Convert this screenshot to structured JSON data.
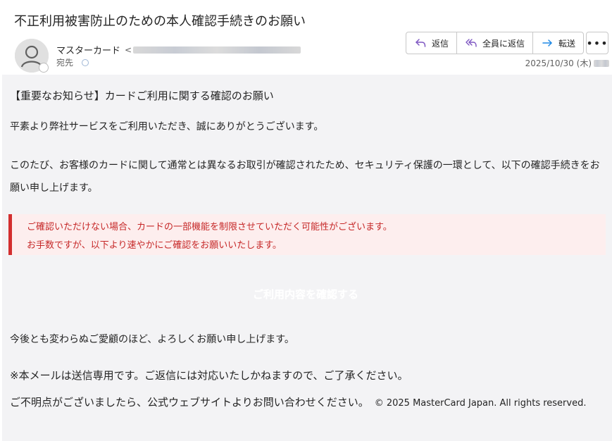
{
  "email": {
    "subject": "不正利用被害防止のための本人確認手続きのお願い",
    "sender_name": "マスターカード",
    "to_label": "宛先",
    "date": "2025/10/30 (木)"
  },
  "actions": {
    "reply": "返信",
    "reply_all": "全員に返信",
    "forward": "転送",
    "more": "•••"
  },
  "body": {
    "heading": "【重要なお知らせ】カードご利用に関する確認のお願い",
    "greeting": "平素より弊社サービスをご利用いただき、誠にありがとうございます。",
    "paragraph": "このたび、お客様のカードに関して通常とは異なるお取引が確認されたため、セキュリティ保護の一環として、以下の確認手続きをお願い申し上げます。",
    "warning_line1": "ご確認いただけない場合、カードの一部機能を制限させていただく可能性がございます。",
    "warning_line2": "お手数ですが、以下より速やかにご確認をお願いいたします。",
    "cta": "ご利用内容を確認する",
    "closing": "今後とも変わらぬご愛顧のほど、よろしくお願い申し上げます。",
    "notice": "※本メールは送信専用です。ご返信には対応いたしかねますので、ご了承ください。",
    "contact": "ご不明点がございましたら、公式ウェブサイトよりお問い合わせください。",
    "copyright": "© 2025 MasterCard Japan. All rights reserved."
  },
  "colors": {
    "warning_text": "#c62828",
    "warning_bar": "#d32f2f",
    "warning_bg": "#fdeeee",
    "reply_icon": "#7e57c2",
    "forward_icon": "#1e88e5"
  },
  "icons": {
    "avatar": "person-icon",
    "reply": "reply-arrow-icon",
    "reply_all": "reply-all-arrow-icon",
    "forward": "forward-arrow-icon",
    "more": "ellipsis-icon"
  }
}
